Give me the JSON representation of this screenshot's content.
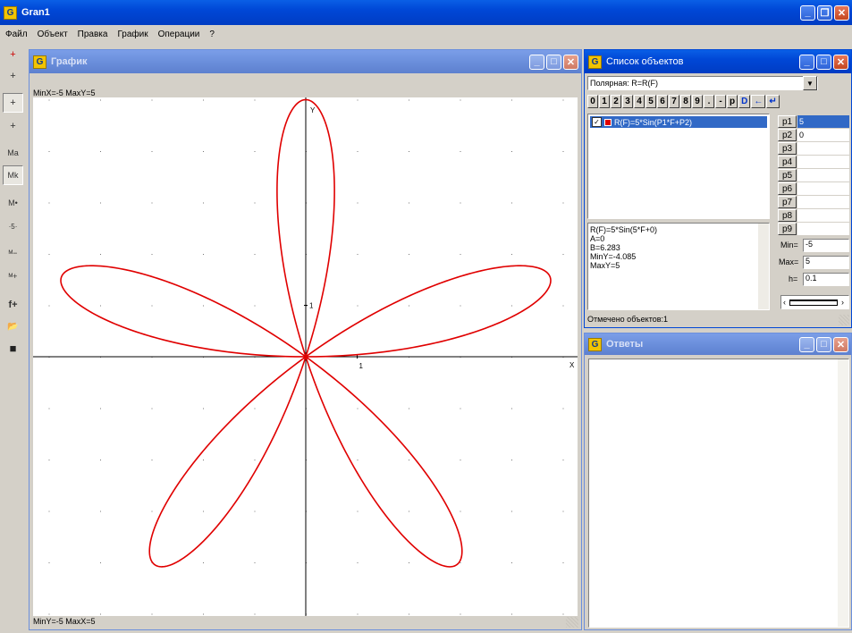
{
  "app": {
    "title": "Gran1"
  },
  "menu": [
    "Файл",
    "Объект",
    "Правка",
    "График",
    "Операции",
    "?"
  ],
  "toolbar": [
    {
      "icon": "axes-icon",
      "glyph": "+"
    },
    {
      "icon": "cross-icon",
      "glyph": "+"
    },
    {
      "icon": "axes-small-icon",
      "glyph": "+"
    },
    {
      "icon": "axes-skew-icon",
      "glyph": "+"
    },
    {
      "icon": "scale-a-icon",
      "glyph": "Ma"
    },
    {
      "icon": "scale-k-icon",
      "glyph": "Mk"
    },
    {
      "icon": "scale-dot-icon",
      "glyph": "M•"
    },
    {
      "icon": "scale-grid-icon",
      "glyph": "·5·"
    },
    {
      "icon": "zoom-out-icon",
      "glyph": "ᴹ−"
    },
    {
      "icon": "zoom-in-icon",
      "glyph": "ᴹ+"
    },
    {
      "icon": "add-function-icon",
      "glyph": "f+"
    },
    {
      "icon": "open-folder-icon",
      "glyph": "📂"
    },
    {
      "icon": "save-disk-icon",
      "glyph": "■"
    }
  ],
  "graph_window": {
    "title": "График",
    "top_status": "MinX=-5  MaxY=5",
    "bottom_status": "MinY=-5  MaxX=5",
    "axis_x_label": "X",
    "axis_y_label": "Y",
    "tick_x_label": "1",
    "tick_y_label": "1"
  },
  "chart_data": {
    "type": "polar",
    "function": "R(F)=5*Sin(5*F+0)",
    "a": 5,
    "k": 5,
    "theta_range": [
      0,
      6.283
    ],
    "xlim": [
      -5,
      5
    ],
    "ylim": [
      -5,
      5
    ],
    "xlabel": "X",
    "ylabel": "Y",
    "grid": "dotted",
    "curve_color": "#e00000"
  },
  "objects_window": {
    "title": "Список объектов",
    "type_select": "Полярная: R=R(F)",
    "keypad": [
      "0",
      "1",
      "2",
      "3",
      "4",
      "5",
      "6",
      "7",
      "8",
      "9",
      ".",
      "-",
      "p",
      "D",
      "←",
      "↵"
    ],
    "object_item": "R(F)=5*Sin(P1*F+P2)",
    "params": [
      {
        "label": "p1",
        "value": "5"
      },
      {
        "label": "p2",
        "value": "0"
      },
      {
        "label": "p3",
        "value": ""
      },
      {
        "label": "p4",
        "value": ""
      },
      {
        "label": "p5",
        "value": ""
      },
      {
        "label": "p6",
        "value": ""
      },
      {
        "label": "p7",
        "value": ""
      },
      {
        "label": "p8",
        "value": ""
      },
      {
        "label": "p9",
        "value": ""
      }
    ],
    "info_lines": [
      "R(F)=5*Sin(5*F+0)",
      "A=0",
      "B=6.283",
      "MinY=-4.085",
      "MaxY=5"
    ],
    "min_label": "Min=",
    "min_value": "-5",
    "max_label": "Max=",
    "max_value": "5",
    "h_label": "h=",
    "h_value": "0.1",
    "status": "Отмечено объектов:1"
  },
  "answers_window": {
    "title": "Ответы"
  },
  "colors": {
    "titlebar": "#0047d6",
    "curve": "#e00000",
    "face": "#d4d0c8"
  }
}
